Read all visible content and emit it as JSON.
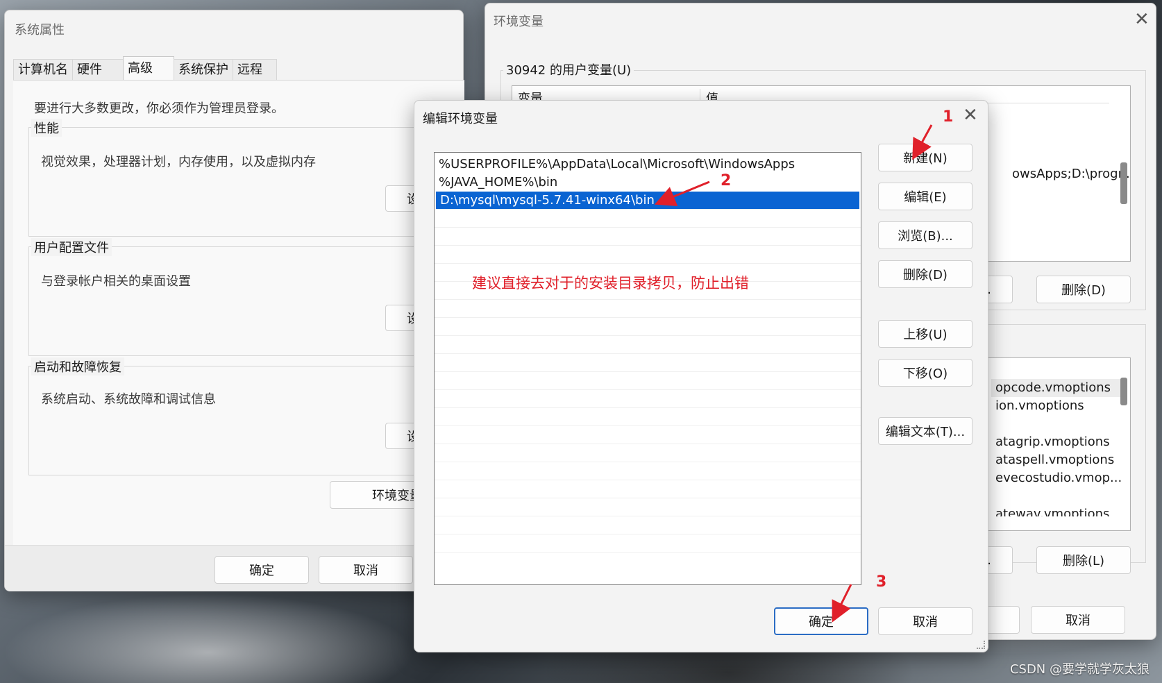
{
  "system_properties": {
    "title": "系统属性",
    "tabs": [
      "计算机名",
      "硬件",
      "高级",
      "系统保护",
      "远程"
    ],
    "active_tab_index": 2,
    "admin_note": "要进行大多数更改，你必须作为管理员登录。",
    "performance": {
      "label": "性能",
      "desc": "视觉效果，处理器计划，内存使用，以及虚拟内存",
      "button": "设"
    },
    "user_profiles": {
      "label": "用户配置文件",
      "desc": "与登录帐户相关的桌面设置",
      "button": "设"
    },
    "startup_recovery": {
      "label": "启动和故障恢复",
      "desc": "系统启动、系统故障和调试信息",
      "button": "设"
    },
    "env_button": "环境变量",
    "ok": "确定",
    "cancel": "取消"
  },
  "env_variables": {
    "title": "环境变量",
    "user_vars_label": "30942 的用户变量(U)",
    "col_variable": "变量",
    "col_value": "值",
    "user_row_value": "owsApps;D:\\progr...",
    "edit_button_partial": "E)...",
    "delete_button": "删除(D)",
    "system_rows": [
      "opcode.vmoptions",
      "ion.vmoptions",
      "",
      "atagrip.vmoptions",
      "ataspell.vmoptions",
      "evecostudio.vmop...",
      "",
      "atewav.vmoptions"
    ],
    "edit_button2_partial": "I)...",
    "delete_button2": "删除(L)",
    "cancel": "取消"
  },
  "edit_env": {
    "title": "编辑环境变量",
    "entries": [
      "%USERPROFILE%\\AppData\\Local\\Microsoft\\WindowsApps",
      "%JAVA_HOME%\\bin",
      "D:\\mysql\\mysql-5.7.41-winx64\\bin"
    ],
    "selected_index": 2,
    "buttons": {
      "new": "新建(N)",
      "edit": "编辑(E)",
      "browse": "浏览(B)...",
      "delete": "删除(D)",
      "move_up": "上移(U)",
      "move_down": "下移(O)",
      "edit_text": "编辑文本(T)..."
    },
    "ok": "确定",
    "cancel": "取消"
  },
  "annotations": {
    "step1": "1",
    "step2": "2",
    "step3": "3",
    "note": "建议直接去对于的安装目录拷贝，防止出错",
    "color": "#e0202a"
  },
  "watermark": "CSDN @要学就学灰太狼",
  "colors": {
    "selection": "#0a64d2",
    "primary_border": "#2b6cc4"
  }
}
